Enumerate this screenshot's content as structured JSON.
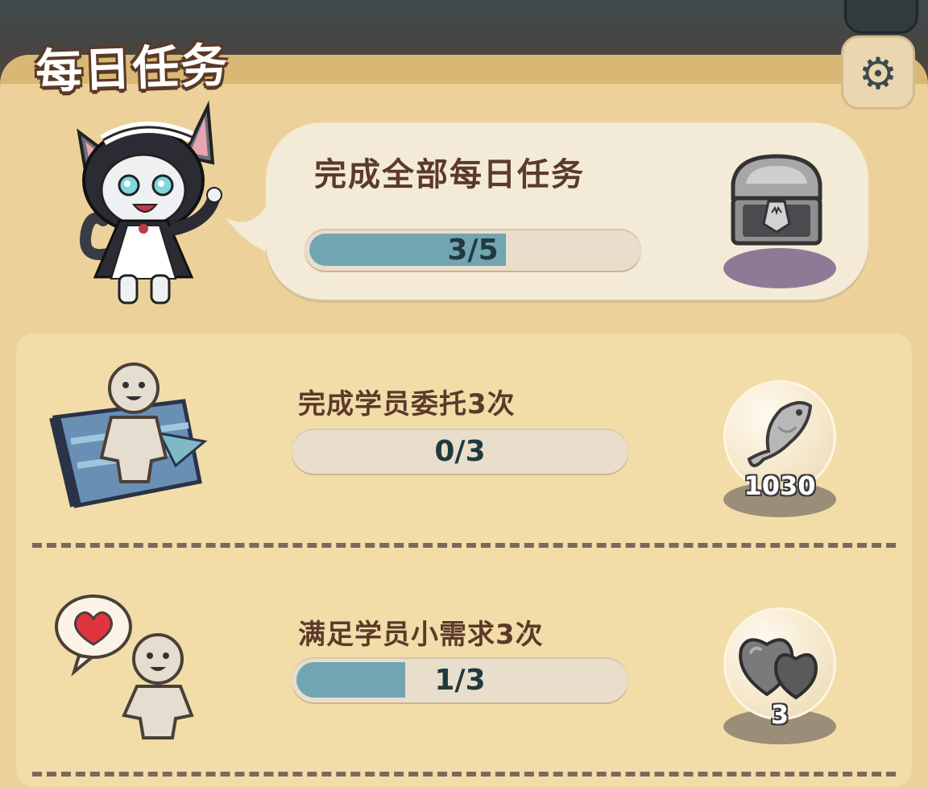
{
  "header": {
    "title": "每日任务",
    "settings_icon": "gear-icon"
  },
  "summary": {
    "title": "完成全部每日任务",
    "progress_text": "3/5",
    "progress_fraction": 0.6,
    "reward_icon": "treasure-chest-icon"
  },
  "tasks": [
    {
      "title": "完成学员委托3次",
      "progress_text": "0/3",
      "progress_fraction": 0,
      "icon": "commission-scroll-icon",
      "reward_icon": "fish-icon",
      "reward_count": "1030"
    },
    {
      "title": "满足学员小需求3次",
      "progress_text": "1/3",
      "progress_fraction": 0.333,
      "icon": "heart-request-icon",
      "reward_icon": "hearts-icon",
      "reward_count": "3"
    }
  ],
  "colors": {
    "progress_fill": "#72a5b2",
    "title_text": "#5b3a2a",
    "panel": "#ecd29a"
  }
}
